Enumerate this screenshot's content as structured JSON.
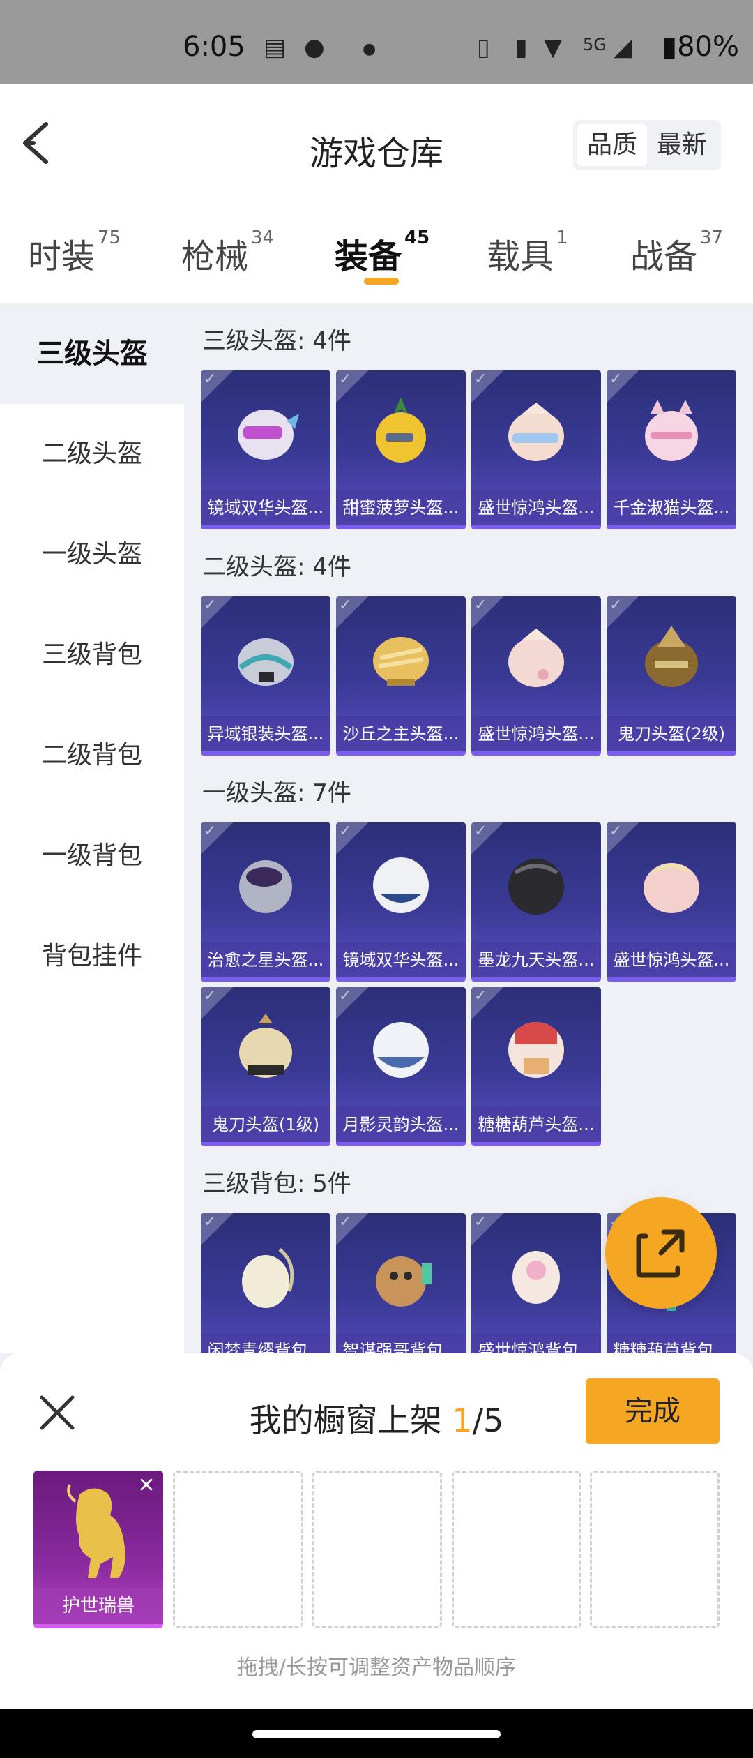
{
  "status_bar": {
    "time": "6:05",
    "network": "5G",
    "battery": "80%"
  },
  "header": {
    "title": "游戏仓库",
    "sort_quality": "品质",
    "sort_latest": "最新"
  },
  "tabs": [
    {
      "label": "时装",
      "count": "75"
    },
    {
      "label": "枪械",
      "count": "34"
    },
    {
      "label": "装备",
      "count": "45"
    },
    {
      "label": "载具",
      "count": "1"
    },
    {
      "label": "战备",
      "count": "37"
    }
  ],
  "active_tab": "装备",
  "sidebar": {
    "items": [
      {
        "label": "三级头盔"
      },
      {
        "label": "二级头盔"
      },
      {
        "label": "一级头盔"
      },
      {
        "label": "三级背包"
      },
      {
        "label": "二级背包"
      },
      {
        "label": "一级背包"
      },
      {
        "label": "背包挂件"
      }
    ]
  },
  "sections": [
    {
      "title": "三级头盔: 4件",
      "items": [
        "镜域双华头盔...",
        "甜蜜菠萝头盔...",
        "盛世惊鸿头盔...",
        "千金淑猫头盔..."
      ]
    },
    {
      "title": "二级头盔: 4件",
      "items": [
        "异域银装头盔...",
        "沙丘之主头盔...",
        "盛世惊鸿头盔...",
        "鬼刀头盔(2级)"
      ]
    },
    {
      "title": "一级头盔: 7件",
      "items": [
        "治愈之星头盔...",
        "镜域双华头盔...",
        "墨龙九天头盔...",
        "盛世惊鸿头盔...",
        "鬼刀头盔(1级)",
        "月影灵韵头盔...",
        "糖糖葫芦头盔..."
      ]
    },
    {
      "title": "三级背包: 5件",
      "items": [
        "闲梦青缨背包...",
        "智谋强哥背包...",
        "盛世惊鸿背包...",
        "糖糖葫芦背包..."
      ]
    }
  ],
  "sheet": {
    "title": "我的橱窗上架",
    "count_current": "1",
    "count_total": "/5",
    "done_label": "完成",
    "slot_item": "护世瑞兽",
    "hint": "拖拽/长按可调整资产物品顺序"
  },
  "colors": {
    "accent": "#f5a623",
    "item_bg": "#3a3a96",
    "item_border": "#7a5cf0",
    "legendary_bg": "#8a2a9e"
  }
}
